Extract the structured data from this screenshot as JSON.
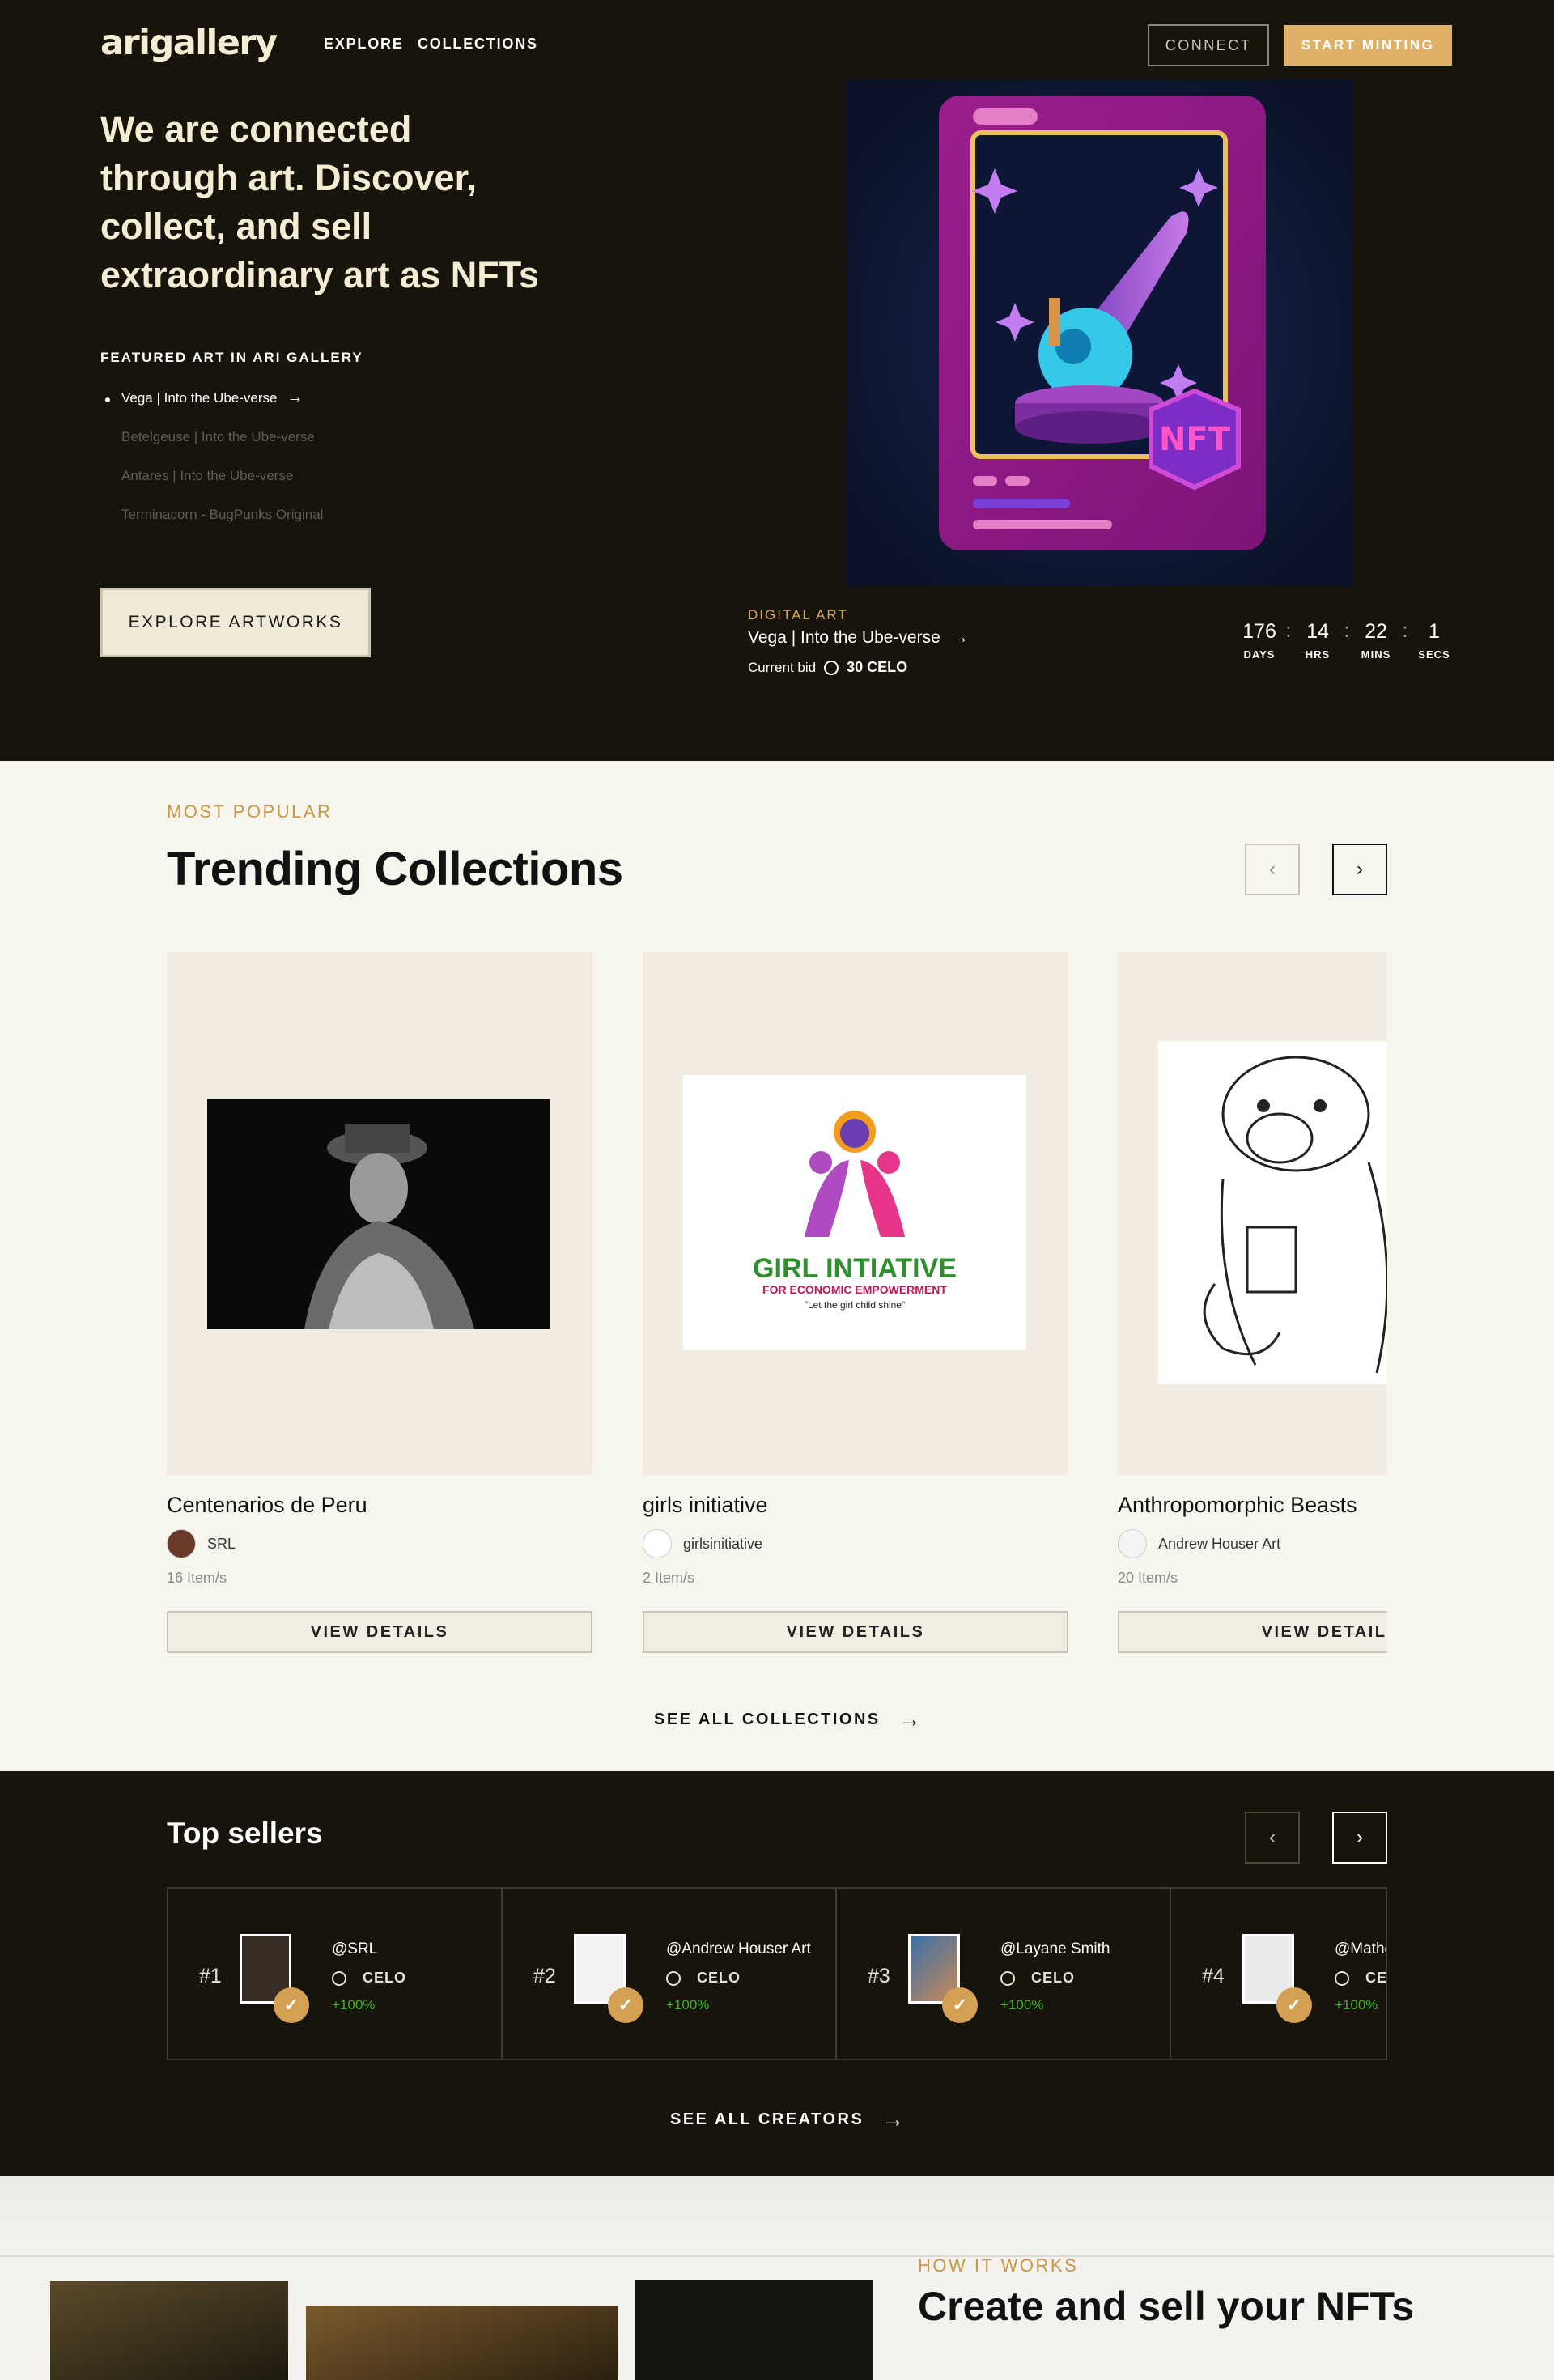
{
  "header": {
    "logo": "arigallery",
    "nav": [
      "EXPLORE",
      "COLLECTIONS"
    ],
    "connect_label": "CONNECT",
    "mint_label": "START MINTING"
  },
  "hero": {
    "title": "We are connected through art. Discover, collect, and sell extraordinary art as NFTs",
    "featured_heading": "FEATURED ART IN ARI GALLERY",
    "featured": [
      "Vega | Into the Ube-verse",
      "Betelgeuse | Into the Ube-verse",
      "Antares | Into the Ube-verse",
      "Terminacorn - BugPunks Original"
    ],
    "explore_label": "EXPLORE ARTWORKS",
    "nft_text": "NFT",
    "category": "DIGITAL ART",
    "art_title": "Vega | Into the Ube-verse",
    "bid_label": "Current bid",
    "bid_value": "30 CELO",
    "timer": [
      {
        "value": "176",
        "label": "DAYS"
      },
      {
        "value": "14",
        "label": "HRS"
      },
      {
        "value": "22",
        "label": "MINS"
      },
      {
        "value": "1",
        "label": "SECS"
      }
    ]
  },
  "trending": {
    "eyebrow": "MOST POPULAR",
    "title": "Trending Collections",
    "view_label": "VIEW DETAILS",
    "see_all": "SEE ALL COLLECTIONS",
    "collections": [
      {
        "name": "Centenarios de Peru",
        "owner": "SRL",
        "items": "16 Item/s"
      },
      {
        "name": "girls initiative",
        "owner": "girlsinitiative",
        "items": "2 Item/s"
      },
      {
        "name": "Anthropomorphic Beasts",
        "owner": "Andrew Houser Art",
        "items": "20 Item/s"
      }
    ],
    "girl_logo": {
      "line1": "GIRL INTIATIVE",
      "line2": "FOR ECONOMIC EMPOWERMENT",
      "line3": "\"Let the girl child shine\""
    }
  },
  "sellers": {
    "title": "Top sellers",
    "currency": "CELO",
    "see_all": "SEE ALL CREATORS",
    "list": [
      {
        "rank": "#1",
        "name": "@SRL",
        "change": "+100%"
      },
      {
        "rank": "#2",
        "name": "@Andrew Houser Art",
        "change": "+100%"
      },
      {
        "rank": "#3",
        "name": "@Layane Smith",
        "change": "+100%"
      },
      {
        "rank": "#4",
        "name": "@Mathe",
        "change": "+100%"
      }
    ]
  },
  "how": {
    "eyebrow": "HOW IT WORKS",
    "title": "Create and sell your NFTs"
  },
  "colors": {
    "dark_bg": "#17150b",
    "accent": "#dfb168",
    "cream": "#f6f5ee",
    "positive": "#43b02a"
  }
}
